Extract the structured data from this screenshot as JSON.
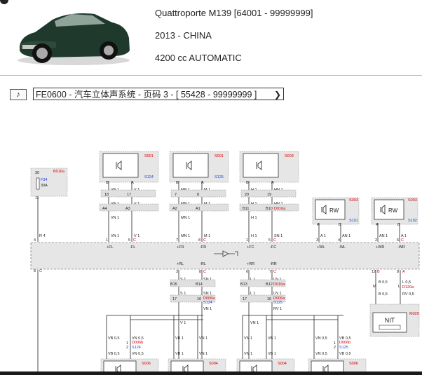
{
  "vehicle": {
    "model": "Quattroporte M139 [64001 - 99999999]",
    "year_market": "2013 - CHINA",
    "engine": "4200 cc AUTOMATIC"
  },
  "toolbar": {
    "note_icon": "music-note-icon",
    "selector_value": "FE0600 - 汽车立体声系统 - 页码 3 - [ 55428 - 99999999 ]"
  },
  "diagram": {
    "fuse": {
      "ref": "B016a",
      "pin_top": "30",
      "pin_bottom": "11",
      "name": "F34",
      "rating": "30A",
      "wire": "R 4",
      "wire_bottom": "R 4",
      "conn_pin": "4",
      "conn_pin_bottom": "8",
      "conn_label": "+30",
      "c_letter": "C"
    },
    "speakers_top": [
      {
        "ref": "S001",
        "sref": "S124",
        "pins": [
          "B",
          "A"
        ],
        "w1": "VN 1",
        "w2": "V 1",
        "p1": "18",
        "p2": "17",
        "conn": [
          "A4",
          "A3"
        ],
        "n1": "1",
        "n2": "5",
        "lbl1": "+FL",
        "lbl2": "-FL",
        "c": "C"
      },
      {
        "ref": "S001",
        "sref": "S125",
        "pins": [
          "B",
          "A"
        ],
        "w1": "MN 1",
        "w2": "M 1",
        "p1": "7",
        "p2": "8",
        "conn": [
          "A2",
          "A1"
        ],
        "n1": "7",
        "n2": "8",
        "lbl1": "+FR",
        "lbl2": "-FR",
        "c": "C"
      },
      {
        "ref": "S003",
        "sref": "",
        "pins": [
          "B",
          "A"
        ],
        "w1": "H 1",
        "w2": "HN 1",
        "p1": "20",
        "p2": "19",
        "conn": [
          "B11",
          "B10"
        ],
        "n1": "1",
        "n2": "5",
        "lbl1": "+FC",
        "lbl2": "-FC",
        "c": "C",
        "wref": "D001a",
        "wref2": "D016a",
        "w3": "SN 1"
      }
    ],
    "speakers_rw": [
      {
        "ref": "S003",
        "sref": "S101",
        "label": "RW",
        "pins": [
          "A",
          "B"
        ],
        "w1": "A 1",
        "w2": "AN 1",
        "n1": "3",
        "n2": "4",
        "lbl1": "+WL",
        "lbl2": "-WL"
      },
      {
        "ref": "S003",
        "sref": "S102",
        "label": "RW",
        "pins": [
          "A",
          "B"
        ],
        "w1": "AN 1",
        "w2": "A 1",
        "n1": "2",
        "n2": "6",
        "lbl1": "+WR",
        "lbl2": "-WR",
        "c": "C"
      }
    ],
    "rear": [
      {
        "n1": "3",
        "n2": "8",
        "lbl1": "+RL",
        "lbl2": "-RL",
        "conn": [
          "B15",
          "B14"
        ],
        "w1": "S 1",
        "w2": "SN 1",
        "p1": "17",
        "p2": "16",
        "wref": "D006a",
        "sref": "S124",
        "w3": "VN 1",
        "w4": "V 1"
      },
      {
        "n1": "6",
        "n2": "7",
        "lbl1": "+RR",
        "lbl2": "-RR",
        "conn": [
          "B13",
          "B12"
        ],
        "w1": "L 1",
        "w2": "LN 1",
        "p1": "17",
        "p2": "16",
        "wref": "D006a",
        "sref": "S125",
        "w3": "RV 1",
        "w4": "VN 1",
        "wref2": "D016a"
      }
    ],
    "nit": {
      "label": "NIT",
      "ref": "M020",
      "pins_top": [
        "12",
        "8"
      ],
      "c_top": "B",
      "c_top2": "A",
      "w1": "B 0,5",
      "w2": "L 0,5",
      "conn": [
        "M",
        "L"
      ],
      "cref": "D120a",
      "n1": "6",
      "n2": "7",
      "c": "C",
      "c2": "F",
      "w3": "RV 0,5"
    },
    "bottom_speakers": [
      {
        "ref": "S006",
        "sref": "S124",
        "w": "VB 0,5",
        "w2": "VN 0,5",
        "pin": "1",
        "pin2": "2",
        "wref": "D006b"
      },
      {
        "ref": "S004",
        "sref": "",
        "w": "VB 1",
        "w2": "VN 1"
      },
      {
        "ref": "S004",
        "sref": "",
        "w": "VN 1",
        "w2": "VB 1"
      },
      {
        "ref": "S006",
        "sref": "S125",
        "w": "VN 0,5",
        "w2": "VB 0,5",
        "pin": "1",
        "pin2": "2",
        "wref": "D006b"
      }
    ],
    "ground_wire": "N 4",
    "colors": {
      "ref_red": "#d40000",
      "ref_blue": "#1a3fd0",
      "box_fill": "#e6e6e6",
      "line": "#222222"
    }
  }
}
